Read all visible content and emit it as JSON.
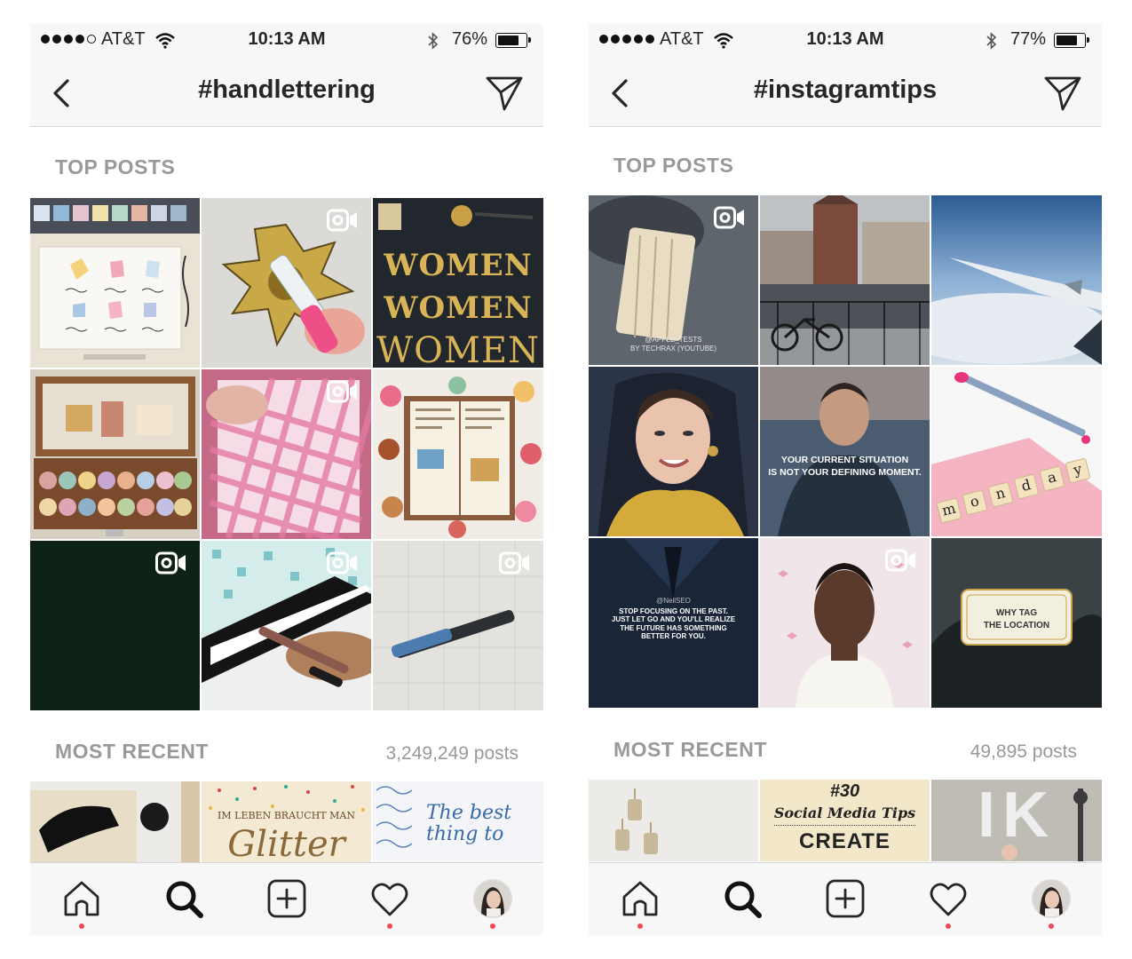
{
  "colors": {
    "accent_notification": "#ed4956",
    "secondary_text": "#999999",
    "bar_bg": "#f7f7f7"
  },
  "left": {
    "status": {
      "carrier": "AT&T",
      "time": "10:13 AM",
      "battery_pct": "76%",
      "battery_level": 0.76,
      "signal_bars_filled": 4
    },
    "nav": {
      "title": "#handlettering",
      "back_icon": "chevron-left-icon",
      "send_icon": "direct-send-icon"
    },
    "top_posts_label": "TOP POSTS",
    "most_recent_label": "MOST RECENT",
    "post_count": "3,249,249 posts",
    "top_posts": [
      {
        "desc": "watercolor gem lettering",
        "video": false
      },
      {
        "desc": "painted flower with brush pen",
        "video": true
      },
      {
        "desc": "gold lettering",
        "video": false,
        "text_lines": [
          "WOMEN",
          "WOMEN",
          "WOMEN"
        ]
      },
      {
        "desc": "vintage case of washi tape",
        "video": false
      },
      {
        "desc": "pink plaid painting",
        "video": true
      },
      {
        "desc": "journal with macarons",
        "video": false
      },
      {
        "desc": "dark green",
        "video": true
      },
      {
        "desc": "hand with brush pen",
        "video": true
      },
      {
        "desc": "blue marker",
        "video": true
      }
    ],
    "recent_posts": [
      {
        "desc": "black brush stroke"
      },
      {
        "desc": "glitter lettering",
        "text_lines": [
          "IM LEBEN BRAUCHT MAN",
          "Glitter"
        ]
      },
      {
        "desc": "blue calligraphy",
        "text_lines": [
          "The best thing to"
        ]
      }
    ],
    "tabs": [
      {
        "name": "home",
        "icon": "home-icon",
        "notify": true
      },
      {
        "name": "search",
        "icon": "search-icon",
        "notify": false
      },
      {
        "name": "add",
        "icon": "add-icon",
        "notify": false
      },
      {
        "name": "activity",
        "icon": "heart-icon",
        "notify": true
      },
      {
        "name": "profile",
        "icon": "avatar-icon",
        "notify": true
      }
    ]
  },
  "right": {
    "status": {
      "carrier": "AT&T",
      "time": "10:13 AM",
      "battery_pct": "77%",
      "battery_level": 0.77,
      "signal_bars_filled": 5
    },
    "nav": {
      "title": "#instagramtips",
      "back_icon": "chevron-left-icon",
      "send_icon": "direct-send-icon"
    },
    "top_posts_label": "TOP POSTS",
    "most_recent_label": "MOST RECENT",
    "post_count": "49,895 posts",
    "top_posts": [
      {
        "desc": "phone case",
        "video": true,
        "text_lines": [
          "@APPLE_TESTS",
          "BY TECHRAX (YOUTUBE)"
        ]
      },
      {
        "desc": "city canal with bicycle",
        "video": false
      },
      {
        "desc": "airplane wing over clouds",
        "video": false
      },
      {
        "desc": "smiling woman with yellow scarf",
        "video": false
      },
      {
        "desc": "man quote",
        "video": false,
        "text_lines": [
          "YOUR CURRENT SITUATION",
          "IS NOT YOUR DEFINING MOMENT."
        ]
      },
      {
        "desc": "pink pen with letter blocks",
        "video": false,
        "letters": [
          "m",
          "o",
          "n",
          "d",
          "a",
          "y"
        ]
      },
      {
        "desc": "motivational quote on dark",
        "video": false,
        "text_lines": [
          "@NeilSEO",
          "STOP FOCUSING ON THE PAST.",
          "JUST LET GO AND YOU'LL REALIZE",
          "THE FUTURE HAS SOMETHING",
          "BETTER FOR YOU."
        ]
      },
      {
        "desc": "woman video selfie",
        "video": true
      },
      {
        "desc": "why tag the location",
        "video": false,
        "text_lines": [
          "WHY TAG",
          "THE LOCATION"
        ]
      }
    ],
    "recent_posts": [
      {
        "desc": "binder clips"
      },
      {
        "desc": "social media tips",
        "text_lines": [
          "#30",
          "Social Media Tips",
          "CREATE"
        ]
      },
      {
        "desc": "balloon letters",
        "text_lines": [
          "IK"
        ]
      }
    ],
    "tabs": [
      {
        "name": "home",
        "icon": "home-icon",
        "notify": true
      },
      {
        "name": "search",
        "icon": "search-icon",
        "notify": false
      },
      {
        "name": "add",
        "icon": "add-icon",
        "notify": false
      },
      {
        "name": "activity",
        "icon": "heart-icon",
        "notify": true
      },
      {
        "name": "profile",
        "icon": "avatar-icon",
        "notify": true
      }
    ]
  }
}
